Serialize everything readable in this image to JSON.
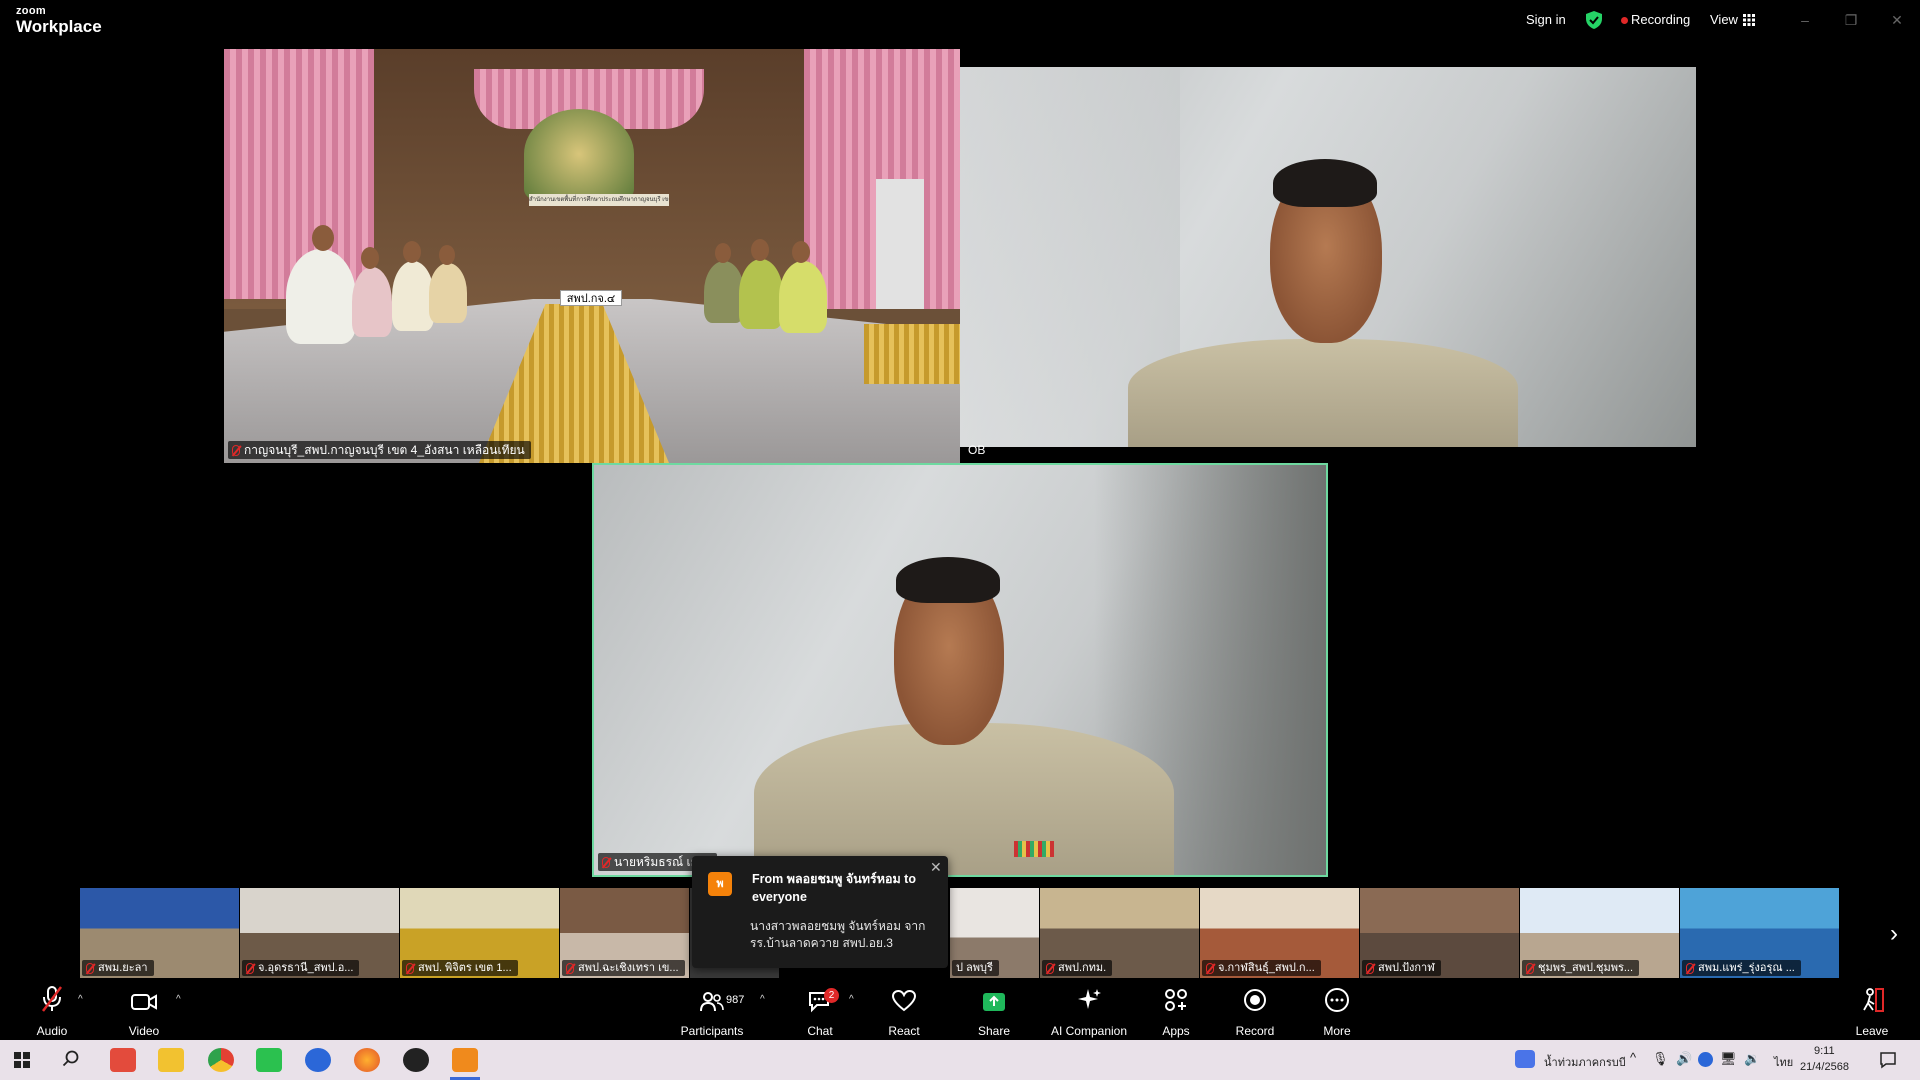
{
  "titlebar": {
    "logo_small": "zoom",
    "logo_big": "Workplace",
    "sign_in": "Sign in",
    "recording": "Recording",
    "view": "View"
  },
  "tiles": {
    "room": {
      "name": "กาญจนบุรี_สพป.กาญจนบุรี เขต 4_อังสนา เหลือนเทียน",
      "nameplate": "สพป.กจ.๔",
      "banner": "สำนักงานเขตพื้นที่การศึกษาประถมศึกษากาญจนบุรี เขต ๔"
    },
    "top_right": {
      "name": "OB"
    },
    "main": {
      "name": "นายหริมธรณ์ เยงพ"
    }
  },
  "filmstrip": [
    {
      "name": "สพม.ยะลา"
    },
    {
      "name": "จ.อุดรธานี_สพป.อ..."
    },
    {
      "name": "สพป. พิจิตร เขต 1..."
    },
    {
      "name": "สพป.ฉะเชิงเทรา เข..."
    },
    {
      "name": ""
    },
    {
      "name": "ป ลพบุรี"
    },
    {
      "name": "สพป.กทม."
    },
    {
      "name": "จ.กาฬสินธุ์_สพป.ก..."
    },
    {
      "name": "สพป.ปังกาฬ"
    },
    {
      "name": "ชุมพร_สพป.ชุมพร..."
    },
    {
      "name": "สพม.แพร่_รุ่งอรุณ ..."
    }
  ],
  "toast": {
    "avatar_letter": "พ",
    "title": "From พลอยชมพู จันทร์หอม to everyone",
    "message": "นางสาวพลอยชมพู จันทร์หอม จาก รร.บ้านลาดควาย สพป.อย.3"
  },
  "toolbar": {
    "audio": "Audio",
    "video": "Video",
    "participants": "Participants",
    "participants_count": "987",
    "chat": "Chat",
    "chat_badge": "2",
    "react": "React",
    "share": "Share",
    "ai_companion": "AI Companion",
    "apps": "Apps",
    "record": "Record",
    "more": "More",
    "leave": "Leave"
  },
  "taskbar": {
    "location": "น้ำท่วมภาคกรบบี",
    "lang": "ไทย",
    "time": "9:11",
    "date": "21/4/2568"
  },
  "colors": {
    "accent_green": "#25d366",
    "recording_red": "#e02828",
    "share_green": "#1fb85b",
    "active_border": "#6ed9a0"
  }
}
